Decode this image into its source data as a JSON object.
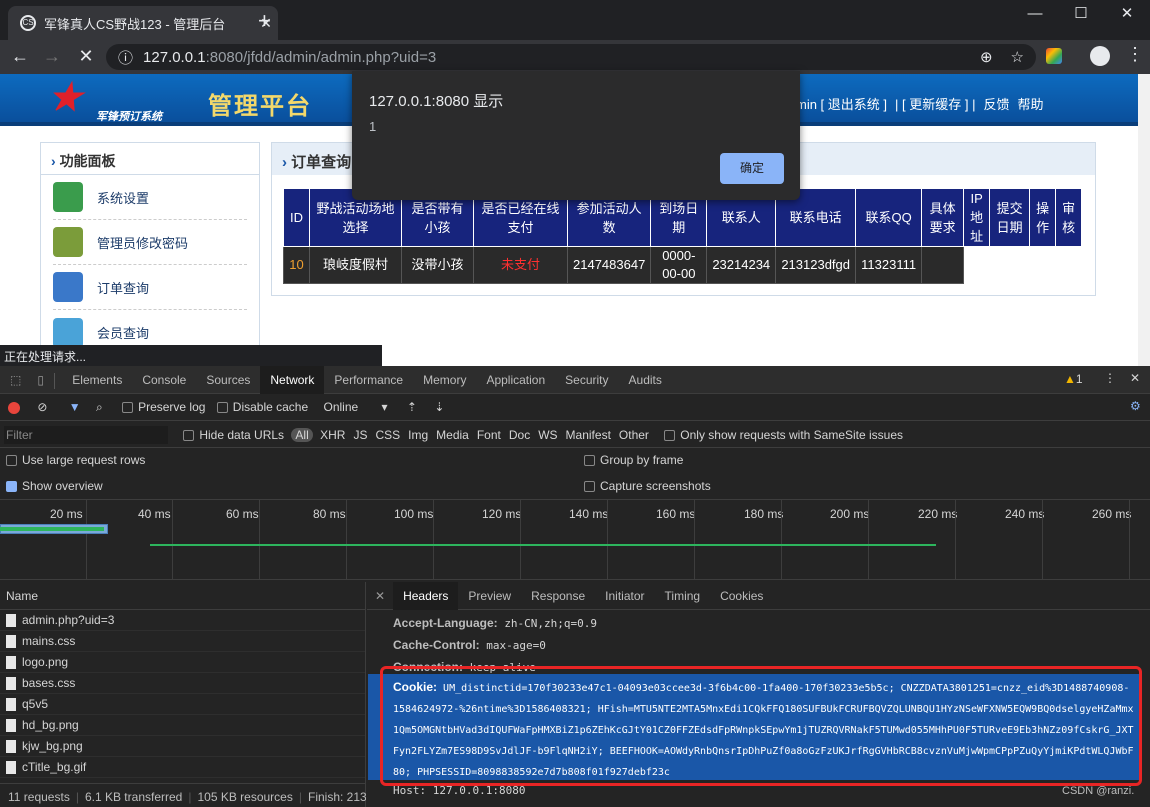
{
  "browser": {
    "tab_title": "军锋真人CS野战123 - 管理后台",
    "url_host": "127.0.0.1",
    "url_rest": ":8080/jfdd/admin/admin.php?uid=3",
    "status_text": "正在处理请求..."
  },
  "page": {
    "logo_text": "军锋预订系统",
    "platform_title": "管理平台",
    "topnav": [
      "min [ 退出系统 ]",
      "| [ 更新缓存 ] |",
      "反馈",
      "帮助"
    ],
    "sidebar": {
      "title": "功能面板",
      "items": [
        {
          "label": "系统设置"
        },
        {
          "label": "管理员修改密码"
        },
        {
          "label": "订单查询"
        },
        {
          "label": "会员查询"
        }
      ]
    },
    "panel_title": "订单查询",
    "table": {
      "headers": [
        "ID",
        "野战活动场地选择",
        "是否带有小孩",
        "是否已经在线支付",
        "参加活动人数",
        "到场日期",
        "联系人",
        "联系电话",
        "联系QQ",
        "具体要求",
        "IP地址",
        "提交日期",
        "操作",
        "审核"
      ],
      "row": [
        "10",
        "琅岐度假村",
        "没带小孩",
        "未支付",
        "2147483647",
        "0000-00-00",
        "23214234",
        "213123dfgd",
        "11323111",
        ""
      ]
    }
  },
  "dialog": {
    "title": "127.0.0.1:8080 显示",
    "message": "1",
    "ok_label": "确定"
  },
  "devtools": {
    "tabs": [
      "Elements",
      "Console",
      "Sources",
      "Network",
      "Performance",
      "Memory",
      "Application",
      "Security",
      "Audits"
    ],
    "warnings": "1",
    "toolbar": {
      "preserve_log": "Preserve log",
      "disable_cache": "Disable cache",
      "throttle": "Online"
    },
    "filter": {
      "placeholder": "Filter",
      "hide_data_urls": "Hide data URLs",
      "types": [
        "All",
        "XHR",
        "JS",
        "CSS",
        "Img",
        "Media",
        "Font",
        "Doc",
        "WS",
        "Manifest",
        "Other"
      ],
      "samesite": "Only show requests with SameSite issues"
    },
    "options": {
      "large_rows": "Use large request rows",
      "group_by_frame": "Group by frame",
      "show_overview": "Show overview",
      "capture": "Capture screenshots"
    },
    "timeline_ticks": [
      "20 ms",
      "40 ms",
      "60 ms",
      "80 ms",
      "100 ms",
      "120 ms",
      "140 ms",
      "160 ms",
      "180 ms",
      "200 ms",
      "220 ms",
      "240 ms",
      "260 ms"
    ],
    "name_header": "Name",
    "requests": [
      "admin.php?uid=3",
      "mains.css",
      "logo.png",
      "bases.css",
      "q5v5",
      "hd_bg.png",
      "kjw_bg.png",
      "cTitle_bg.gif"
    ],
    "summary": [
      "11 requests",
      "6.1 KB transferred",
      "105 KB resources",
      "Finish: 213"
    ],
    "detail_tabs": [
      "Headers",
      "Preview",
      "Response",
      "Initiator",
      "Timing",
      "Cookies"
    ],
    "headers": [
      {
        "k": "Accept-Language:",
        "v": "zh-CN,zh;q=0.9"
      },
      {
        "k": "Cache-Control:",
        "v": "max-age=0"
      },
      {
        "k": "Connection:",
        "v": "keep-alive"
      }
    ],
    "cookie_key": "Cookie:",
    "cookie_value": "UM_distinctid=170f30233e47c1-04093e03ccee3d-3f6b4c00-1fa400-170f30233e5b5c; CNZZDATA3801251=cnzz_eid%3D1488740908-1584624972-%26ntime%3D1586408321; HFish=MTU5NTE2MTA5MnxEdi1CQkFFQ180SUFBUkFCRUFBQVZQLUNBQU1HYzNSeWFXNW5EQW9BQ0dselgyeHZaMmx1Qm5OMGNtbHVad3dIQUFWaFpHMXBiZ1p6ZEhKcGJtY01CZ0FFZEdsdFpRWnpkSEpwYm1jTUZRQVRNakF5TUMwd055MHhPU0F5TURveE9Eb3hNZz09fCskrG_JXTFyn2FLYZm7ES98D9SvJdlJF-b9FlqNH2iY; BEEFHOOK=AOWdyRnbQnsrIpDhPuZf0a8oGzFzUKJrfRgGVHbRCB8cvznVuMjwWpmCPpPZuQyYjmiKPdtWLQJWbF80; PHPSESSID=8098838592e7d7b808f01f927debf23c",
    "host_line": "Host: 127.0.0.1:8080",
    "watermark": "CSDN @ranzi."
  }
}
